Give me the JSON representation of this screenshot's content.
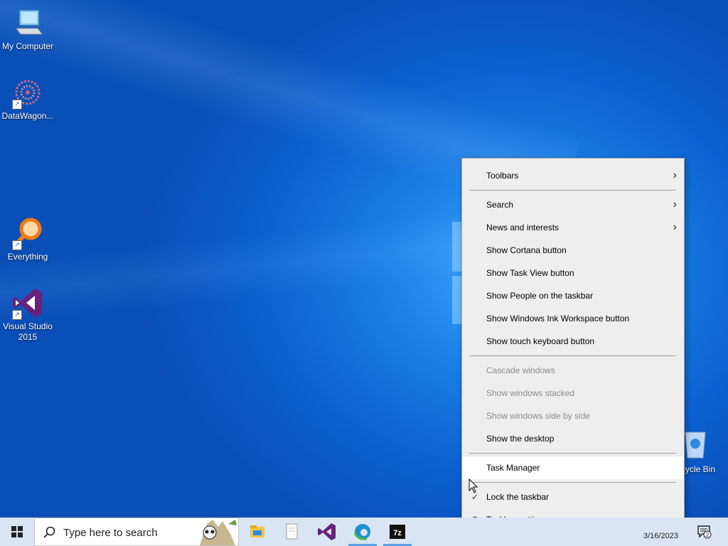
{
  "desktop_icons": [
    {
      "label": "My Computer"
    },
    {
      "label": "DataWagon..."
    },
    {
      "label": "Everything"
    },
    {
      "label": "Visual Studio 2015"
    }
  ],
  "recycle_bin": {
    "label": "cycle Bin"
  },
  "context_menu": {
    "items": [
      {
        "label": "Toolbars",
        "submenu": true
      },
      {
        "label": "Search",
        "submenu": true
      },
      {
        "label": "News and interests",
        "submenu": true
      },
      {
        "label": "Show Cortana button"
      },
      {
        "label": "Show Task View button"
      },
      {
        "label": "Show People on the taskbar"
      },
      {
        "label": "Show Windows Ink Workspace button"
      },
      {
        "label": "Show touch keyboard button"
      },
      {
        "label": "Cascade windows",
        "disabled": true
      },
      {
        "label": "Show windows stacked",
        "disabled": true
      },
      {
        "label": "Show windows side by side",
        "disabled": true
      },
      {
        "label": "Show the desktop"
      },
      {
        "label": "Task Manager",
        "highlighted": true
      },
      {
        "label": "Lock the taskbar",
        "checked": true
      },
      {
        "label": "Taskbar settings",
        "icon": "gear-icon"
      }
    ]
  },
  "taskbar": {
    "search_placeholder": "Type here to search",
    "clock_date": "3/16/2023",
    "notification_count": "2",
    "pinned": [
      {
        "name": "file-explorer-icon"
      },
      {
        "name": "notepad-icon"
      },
      {
        "name": "visual-studio-icon"
      },
      {
        "name": "edge-icon"
      },
      {
        "name": "7zip-icon"
      }
    ]
  },
  "colors": {
    "taskbar": "#d9e5f2",
    "menu_bg": "#eeeeee",
    "menu_hover": "#ffffff",
    "accent": "#0b5fcf"
  }
}
